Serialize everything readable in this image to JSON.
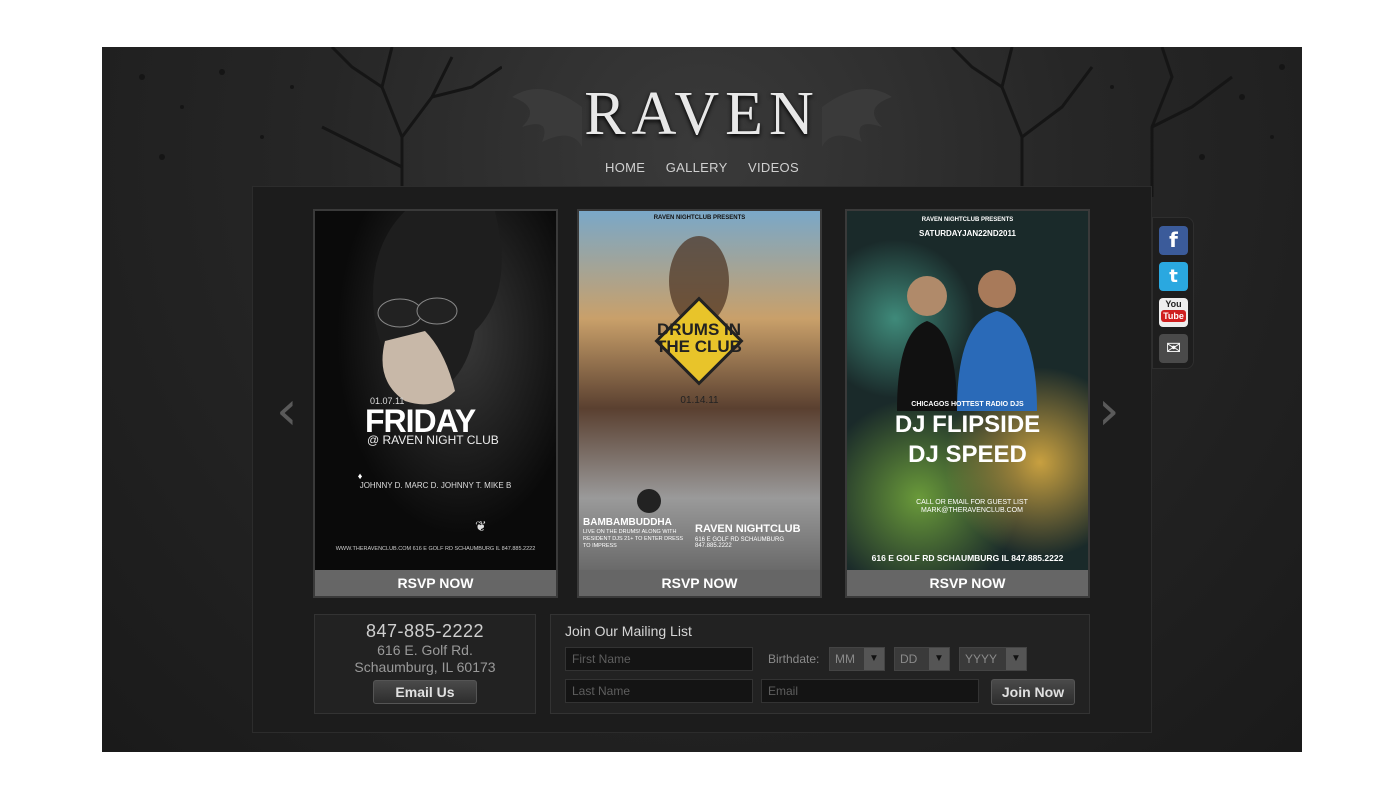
{
  "brand": {
    "logo_text": "RAVEN"
  },
  "nav": {
    "items": [
      "HOME",
      "GALLERY",
      "VIDEOS"
    ]
  },
  "flyers": [
    {
      "date": "01.07.11",
      "headline": "FRIDAY",
      "sub": "@ RAVEN NIGHT CLUB",
      "djs": "JOHNNY D.  MARC D.  JOHNNY T.  MIKE B",
      "footer": "WWW.THERAVENCLUB.COM   616 E GOLF RD SCHAUMBURG IL   847.885.2222",
      "rsvp": "RSVP NOW"
    },
    {
      "top": "RAVEN NIGHTCLUB PRESENTS",
      "headline": "DRUMS IN THE CLUB",
      "date": "01.14.11",
      "artist": "BAMBAMBUDDHA",
      "artist_sub": "LIVE ON THE DRUMS! ALONG WITH RESIDENT DJS 21+ TO ENTER DRESS TO IMPRESS",
      "venue": "RAVEN NIGHTCLUB",
      "venue_sub": "616 E GOLF RD SCHAUMBURG 847.885.2222",
      "rsvp": "RSVP NOW"
    },
    {
      "top": "RAVEN NIGHTCLUB PRESENTS",
      "date": "SATURDAYJAN22ND2011",
      "tag": "CHICAGOS HOTTEST RADIO DJS",
      "headline1": "DJ FLIPSIDE",
      "headline2": "DJ SPEED",
      "note": "CALL OR EMAIL FOR GUEST LIST MARK@THERAVENCLUB.COM",
      "footer": "616 E GOLF RD SCHAUMBURG IL  847.885.2222",
      "rsvp": "RSVP NOW"
    }
  ],
  "social": [
    "facebook-icon",
    "twitter-icon",
    "youtube-icon",
    "email-icon"
  ],
  "contact": {
    "phone": "847-885-2222",
    "address1": "616 E. Golf Rd.",
    "address2": "Schaumburg, IL 60173",
    "email_button": "Email Us"
  },
  "mailing": {
    "title": "Join Our Mailing List",
    "first_name_placeholder": "First Name",
    "last_name_placeholder": "Last Name",
    "email_placeholder": "Email",
    "birthdate_label": "Birthdate:",
    "month": "MM",
    "day": "DD",
    "year": "YYYY",
    "submit": "Join Now"
  },
  "colors": {
    "background": "#262626",
    "panel": "#222222",
    "rsvp_bar": "#666666",
    "accent_yellow": "#e8c42a"
  }
}
